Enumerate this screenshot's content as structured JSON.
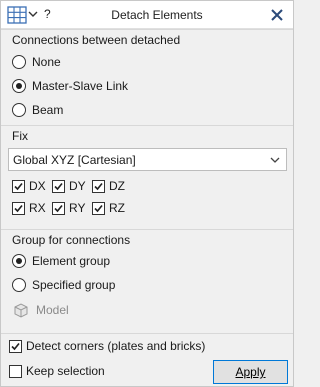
{
  "titlebar": {
    "title": "Detach Elements",
    "help_label": "?",
    "icons": [
      "grid-table-icon",
      "chevron-down-icon",
      "close-icon"
    ]
  },
  "connections": {
    "title": "Connections between detached",
    "options": [
      {
        "label": "None",
        "selected": false
      },
      {
        "label": "Master-Slave Link",
        "selected": true
      },
      {
        "label": "Beam",
        "selected": false
      }
    ]
  },
  "fix": {
    "title": "Fix",
    "coordinate_system": "Global XYZ [Cartesian]",
    "dofs": [
      {
        "label": "DX",
        "checked": true
      },
      {
        "label": "DY",
        "checked": true
      },
      {
        "label": "DZ",
        "checked": true
      },
      {
        "label": "RX",
        "checked": true
      },
      {
        "label": "RY",
        "checked": true
      },
      {
        "label": "RZ",
        "checked": true
      }
    ]
  },
  "group": {
    "title": "Group for connections",
    "options": [
      {
        "label": "Element group",
        "selected": true
      },
      {
        "label": "Specified group",
        "selected": false
      }
    ],
    "model_label": "Model"
  },
  "footer": {
    "detect_corners_label": "Detect corners (plates and bricks)",
    "detect_corners_checked": true,
    "keep_selection_label": "Keep selection",
    "keep_selection_checked": false,
    "apply_label": "Apply",
    "apply_accent": "#0078d7"
  }
}
